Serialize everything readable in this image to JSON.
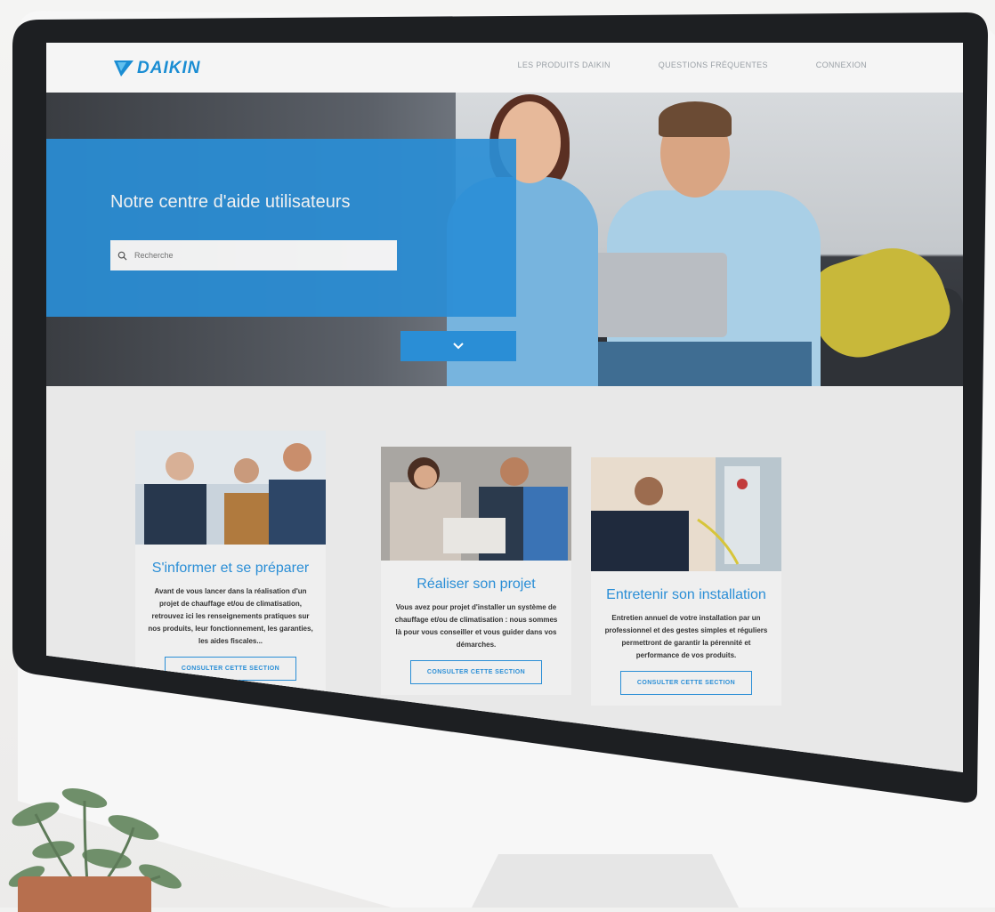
{
  "logo": {
    "text": "DAIKIN",
    "color": "#1a8dd3"
  },
  "nav": {
    "items": [
      {
        "label": "LES PRODUITS DAIKIN"
      },
      {
        "label": "QUESTIONS FRÉQUENTES"
      },
      {
        "label": "CONNEXION"
      }
    ]
  },
  "hero": {
    "title": "Notre centre d'aide utilisateurs",
    "search": {
      "placeholder": "Recherche",
      "icon": "search-icon"
    },
    "scroll_icon": "chevron-down-icon",
    "accent_color": "#2a8ed6"
  },
  "cards": [
    {
      "title": "S'informer et se préparer",
      "text": "Avant de vous lancer dans la réalisation d'un projet de chauffage et/ou de climatisation, retrouvez ici les renseignements pratiques sur nos produits, leur fonctionnement, les garanties, les aides fiscales...",
      "button": "CONSULTER CETTE SECTION"
    },
    {
      "title": "Réaliser son projet",
      "text": "Vous avez pour projet d'installer un système de chauffage et/ou de climatisation : nous sommes là pour vous conseiller et vous guider dans vos démarches.",
      "button": "CONSULTER CETTE SECTION"
    },
    {
      "title": "Entretenir son installation",
      "text": "Entretien annuel de votre installation par un professionnel et des gestes simples et réguliers permettront de garantir la pérennité et performance de vos produits.",
      "button": "CONSULTER CETTE SECTION"
    }
  ]
}
